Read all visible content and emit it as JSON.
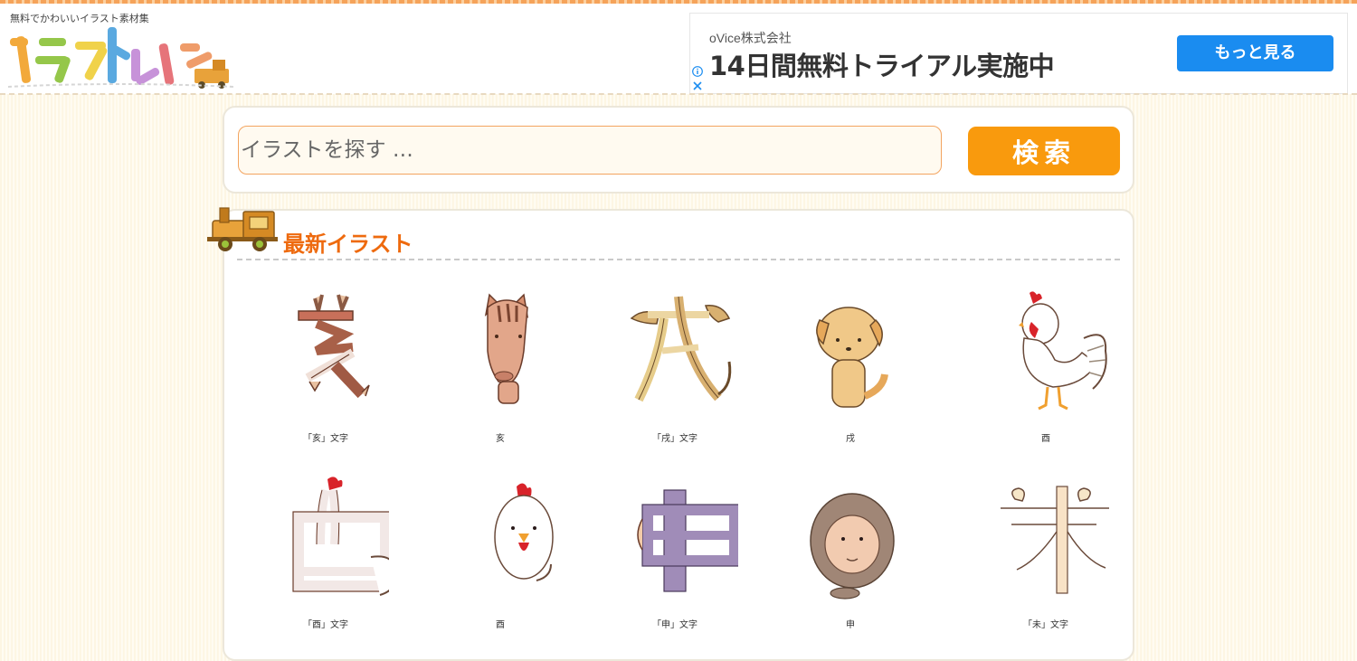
{
  "header": {
    "tagline": "無料でかわいいイラスト素材集",
    "logo_text": "イラストレイン"
  },
  "ad": {
    "company": "oVice株式会社",
    "headline": "14日間無料トライアル実施中",
    "button_label": "もっと見る"
  },
  "search": {
    "placeholder": "イラストを探す …",
    "button_label": "検索"
  },
  "section": {
    "title": "最新イラスト"
  },
  "illustrations": [
    {
      "label": "「亥」文字",
      "icon": "kanji-boar-icon"
    },
    {
      "label": "亥",
      "icon": "boar-icon"
    },
    {
      "label": "「戌」文字",
      "icon": "kanji-dog-icon"
    },
    {
      "label": "戌",
      "icon": "dog-icon"
    },
    {
      "label": "酉",
      "icon": "rooster-icon"
    },
    {
      "label": "「酉」文字",
      "icon": "kanji-rooster-icon"
    },
    {
      "label": "酉",
      "icon": "chick-icon"
    },
    {
      "label": "「申」文字",
      "icon": "kanji-monkey-icon"
    },
    {
      "label": "申",
      "icon": "monkey-icon"
    },
    {
      "label": "「未」文字",
      "icon": "kanji-sheep-icon"
    }
  ],
  "colors": {
    "accent": "#ee6a0e",
    "search_button": "#f99a0d",
    "ad_button": "#1a8cf0"
  }
}
